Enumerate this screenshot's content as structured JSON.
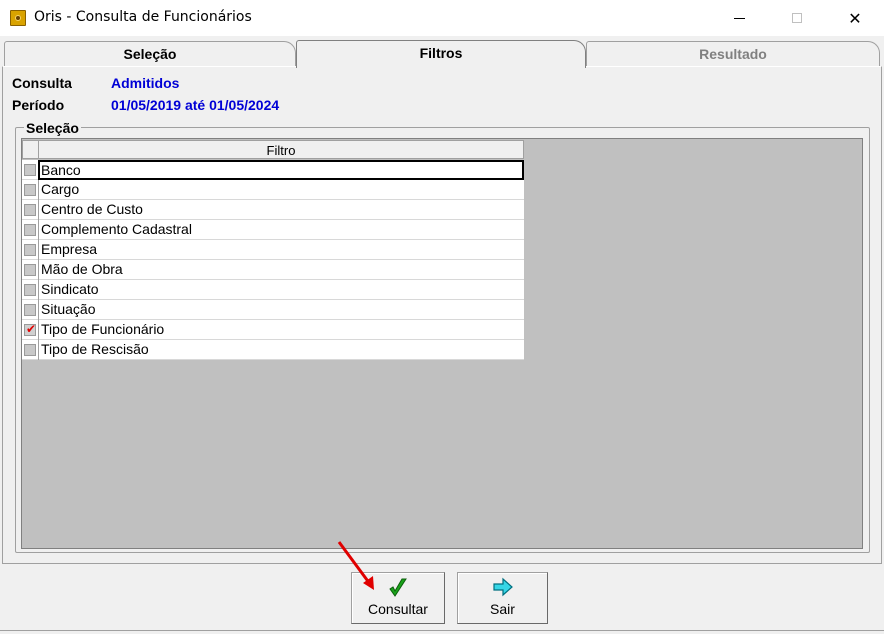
{
  "window": {
    "title": "Oris - Consulta de Funcionários",
    "controls": {
      "minimize": "—",
      "maximize": "☐",
      "close": "✕"
    }
  },
  "tabs": [
    {
      "label": "Seleção",
      "active": false
    },
    {
      "label": "Filtros",
      "active": true
    },
    {
      "label": "Resultado",
      "active": false,
      "disabled": true
    }
  ],
  "info": {
    "consulta_label": "Consulta",
    "consulta_value": "Admitidos",
    "periodo_label": "Período",
    "periodo_value": "01/05/2019 até 01/05/2024"
  },
  "selection_group": {
    "label": "Seleção",
    "column_header": "Filtro",
    "rows": [
      {
        "label": "Banco",
        "checked": false,
        "selected": true
      },
      {
        "label": "Cargo",
        "checked": false
      },
      {
        "label": "Centro de Custo",
        "checked": false
      },
      {
        "label": "Complemento Cadastral",
        "checked": false
      },
      {
        "label": "Empresa",
        "checked": false
      },
      {
        "label": "Mão de Obra",
        "checked": false
      },
      {
        "label": "Sindicato",
        "checked": false
      },
      {
        "label": "Situação",
        "checked": false
      },
      {
        "label": "Tipo de Funcionário",
        "checked": true
      },
      {
        "label": "Tipo de Rescisão",
        "checked": false
      }
    ]
  },
  "buttons": {
    "consultar": {
      "label": "Consultar",
      "icon": "green-checkmark-icon"
    },
    "sair": {
      "label": "Sair",
      "icon": "cyan-arrow-right-icon"
    }
  },
  "colors": {
    "info_value": "#0000d6",
    "grid_background": "#c0c0c0",
    "check_mark": "#e00000",
    "annotation_arrow": "#e00000"
  }
}
